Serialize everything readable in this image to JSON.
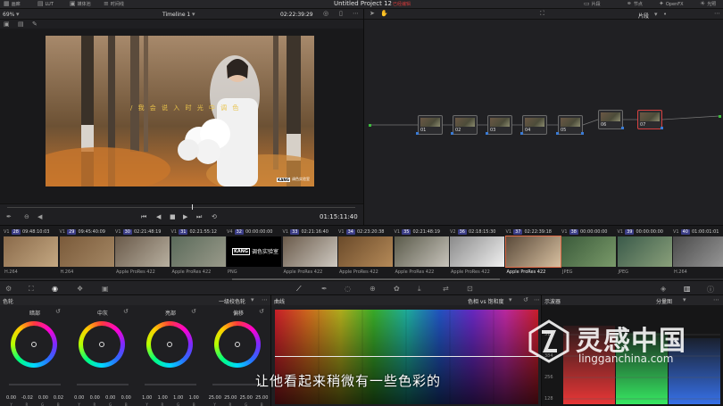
{
  "topbar": {
    "items": [
      "画廊",
      "LUT",
      "媒体池",
      "时间线"
    ],
    "project_title": "Untitled Project 12",
    "project_status": "已经编辑",
    "right_items": [
      "片段",
      "节点",
      "OpenFX",
      "光照"
    ]
  },
  "viewer": {
    "zoom": "69%",
    "timeline_name": "Timeline 1",
    "timecode": "02:22:39:29",
    "subtitle_overlay": "/ 我 会 说 入 时 光 中 调 色",
    "watermark_logo": "KANG",
    "watermark_text": "调色实验室"
  },
  "transport": {
    "timecode": "01:15:11:40"
  },
  "node_editor": {
    "mode": "片段",
    "nodes": [
      "01",
      "02",
      "03",
      "04",
      "05",
      "06",
      "07"
    ],
    "selected_node": "07"
  },
  "clips": [
    {
      "num": "28",
      "tc": "09:48:10:03",
      "track": "V1",
      "codec": "H.264"
    },
    {
      "num": "29",
      "tc": "09:45:40:09",
      "track": "V1",
      "codec": "H.264"
    },
    {
      "num": "30",
      "tc": "02:21:48:19",
      "track": "V1",
      "codec": "Apple ProRes 422"
    },
    {
      "num": "31",
      "tc": "02:21:55:12",
      "track": "V1",
      "codec": "Apple ProRes 422"
    },
    {
      "num": "32",
      "tc": "00:00:00:00",
      "track": "V4",
      "codec": "PNG"
    },
    {
      "num": "33",
      "tc": "02:21:16:40",
      "track": "V1",
      "codec": "Apple ProRes 422"
    },
    {
      "num": "34",
      "tc": "02:23:20:38",
      "track": "V1",
      "codec": "Apple ProRes 422"
    },
    {
      "num": "35",
      "tc": "02:21:48:19",
      "track": "V1",
      "codec": "Apple ProRes 422"
    },
    {
      "num": "36",
      "tc": "02:18:15:30",
      "track": "V2",
      "codec": "Apple ProRes 422"
    },
    {
      "num": "37",
      "tc": "02:22:39:18",
      "track": "V1",
      "codec": "Apple ProRes 422"
    },
    {
      "num": "38",
      "tc": "00:00:00:00",
      "track": "V1",
      "codec": "JPEG"
    },
    {
      "num": "39",
      "tc": "00:00:00:00",
      "track": "V1",
      "codec": "JPEG"
    },
    {
      "num": "40",
      "tc": "01:00:01:01",
      "track": "V1",
      "codec": "H.264"
    }
  ],
  "selected_clip": "37",
  "png_clip_logo": "KANG",
  "png_clip_text": "调色实验室",
  "wheels": {
    "title": "色轮",
    "mode": "一级校色轮",
    "blocks": [
      {
        "label": "暗部",
        "values": [
          "0.00",
          "-0.02",
          "0.00",
          "0.02"
        ]
      },
      {
        "label": "中灰",
        "values": [
          "0.00",
          "0.00",
          "0.00",
          "0.00"
        ]
      },
      {
        "label": "亮部",
        "values": [
          "1.00",
          "1.00",
          "1.00",
          "1.00"
        ]
      },
      {
        "label": "偏移",
        "values": [
          "25.00",
          "25.00",
          "25.00",
          "25.00"
        ]
      }
    ],
    "channels": [
      "Y",
      "R",
      "G",
      "B"
    ]
  },
  "curves": {
    "title": "曲线",
    "mode": "色相 vs 饱和度"
  },
  "scopes": {
    "title": "示波器",
    "mode": "分量图",
    "ticks": [
      "512",
      "384",
      "256",
      "128"
    ]
  },
  "caption": "让他看起来稍微有一些色彩的",
  "brand_watermark": {
    "title": "灵感中国",
    "url": "lingganchina.com"
  },
  "colors": {
    "accent": "#3b3d86",
    "selected": "#d64141",
    "caption": "#ffffff"
  }
}
